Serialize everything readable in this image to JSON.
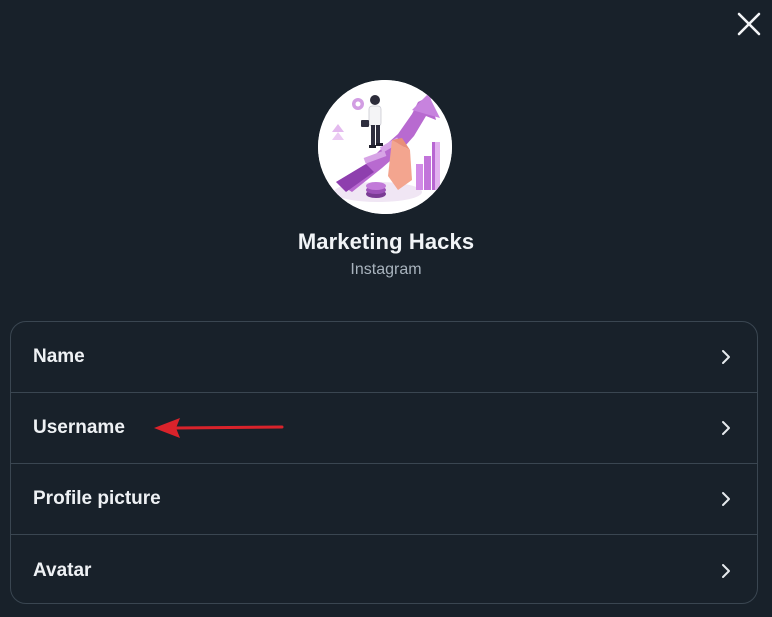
{
  "dialog": {
    "close_icon": "close-icon"
  },
  "account": {
    "name": "Marketing Hacks",
    "platform": "Instagram",
    "avatar": "marketing-growth-illustration"
  },
  "menu": {
    "items": [
      {
        "label": "Name",
        "icon": "chevron-right-icon"
      },
      {
        "label": "Username",
        "icon": "chevron-right-icon"
      },
      {
        "label": "Profile picture",
        "icon": "chevron-right-icon"
      },
      {
        "label": "Avatar",
        "icon": "chevron-right-icon"
      }
    ]
  },
  "annotation": {
    "type": "arrow",
    "points_to": "Username",
    "color": "#d9232b"
  },
  "colors": {
    "background": "#18212a",
    "border": "#3a4651",
    "text_primary": "#eef1f4",
    "text_secondary": "#a8b3bd"
  }
}
